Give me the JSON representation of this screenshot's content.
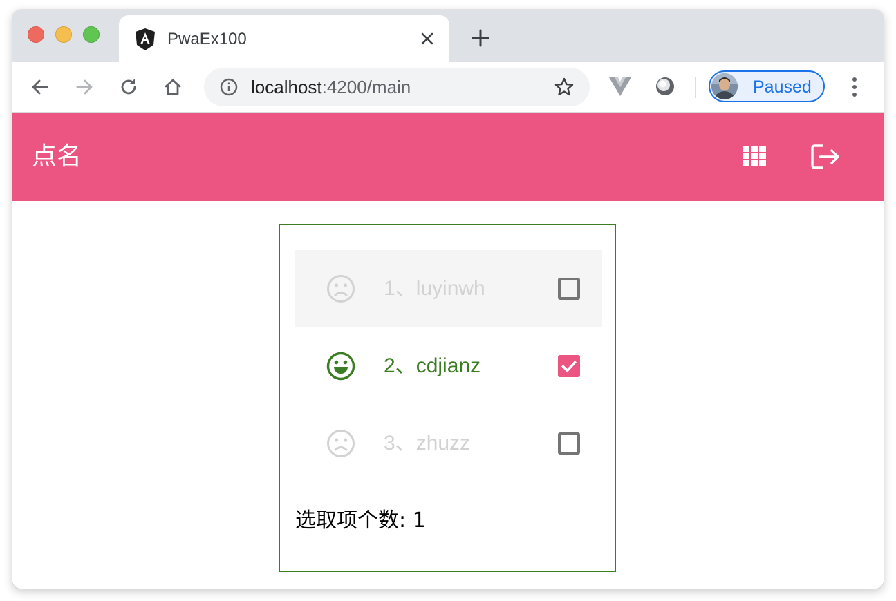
{
  "browser": {
    "tab_title": "PwaEx100",
    "url_host": "localhost",
    "url_path": ":4200/main",
    "profile_label": "Paused",
    "icons": {
      "back": "arrow-left-icon",
      "forward": "arrow-right-icon",
      "reload": "reload-icon",
      "home": "home-icon",
      "site_info": "info-icon",
      "bookmark": "star-icon",
      "extension_vue": "vue-icon",
      "extension_other": "extension-icon",
      "menu": "more-vertical-icon"
    }
  },
  "app_bar": {
    "title": "点名",
    "color": "#ec5482",
    "actions": [
      "apps-grid-icon",
      "logout-icon"
    ]
  },
  "roster": {
    "items": [
      {
        "number": "1、",
        "name": "luyinwh",
        "checked": false,
        "present": false
      },
      {
        "number": "2、",
        "name": "cdjianz",
        "checked": true,
        "present": true
      },
      {
        "number": "3、",
        "name": "zhuzz",
        "checked": false,
        "present": false
      }
    ],
    "selected_count_label": "选取项个数: 1"
  },
  "colors": {
    "accent": "#ec5482",
    "present": "#3a7d22",
    "absent": "#d2d2d2"
  }
}
